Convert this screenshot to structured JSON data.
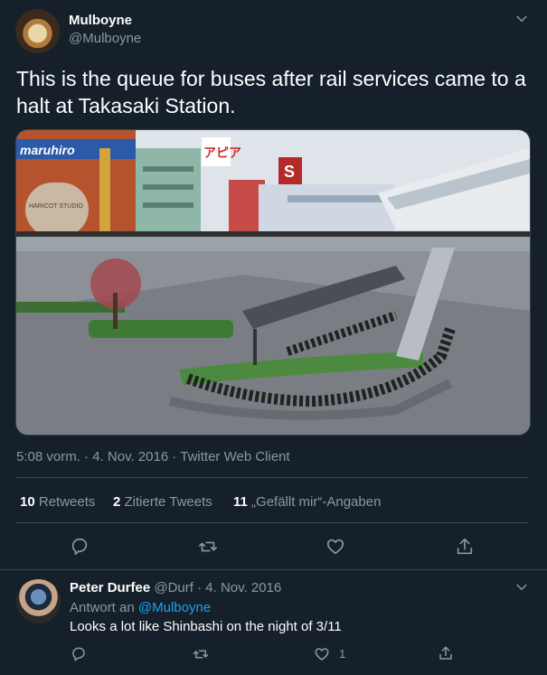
{
  "tweet": {
    "author_name": "Mulboyne",
    "author_handle": "@Mulboyne",
    "text": "This is the queue for buses after rail services came to a halt at Takasaki Station.",
    "media": {
      "sign_maruhiro": "maruhiro",
      "sign_harigot": "HARICOT STUDIO",
      "sign_kanji": "アピア",
      "sign_s": "S"
    },
    "time": "5:08 vorm.",
    "date": "4. Nov. 2016",
    "client": "Twitter Web Client",
    "stats": {
      "retweets_count": "10",
      "retweets_label": "Retweets",
      "quotes_count": "2",
      "quotes_label": "Zitierte Tweets",
      "likes_count": "11",
      "likes_label": "„Gefällt mir“-Angaben"
    }
  },
  "reply": {
    "author_name": "Peter Durfee",
    "author_handle": "@Durf",
    "date": "4. Nov. 2016",
    "reply_to_prefix": "Antwort an",
    "reply_to_handle": "@Mulboyne",
    "text": "Looks a lot like Shinbashi on the night of 3/11",
    "like_count": "1"
  },
  "colors": {
    "background": "#15202b",
    "muted": "#8899a6",
    "divider": "#38444d",
    "link": "#1da1f2"
  },
  "icons": [
    "chevron-down-icon",
    "reply-icon",
    "retweet-icon",
    "like-icon",
    "share-icon"
  ]
}
